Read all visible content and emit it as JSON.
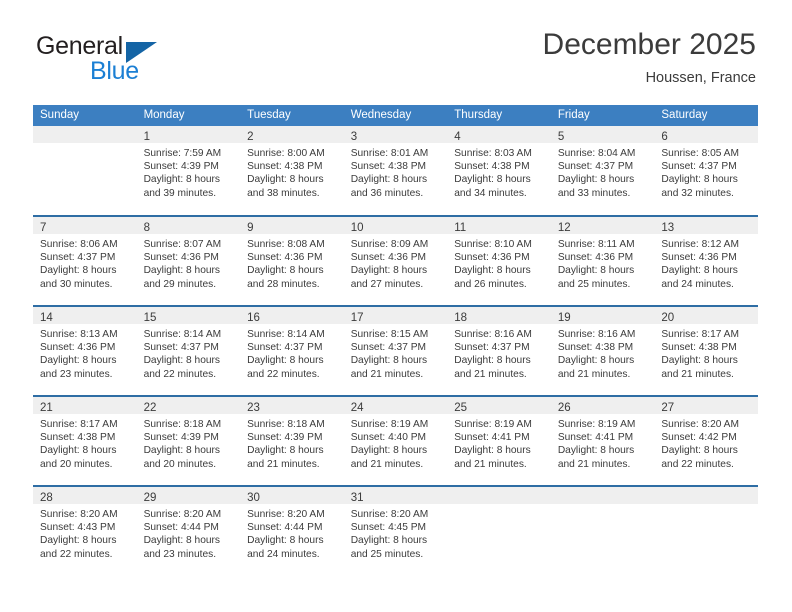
{
  "brand": {
    "name_top": "General",
    "name_bottom": "Blue",
    "accent_color": "#1b7fd4",
    "triangle_color": "#1464a5"
  },
  "header": {
    "title": "December 2025",
    "location": "Houssen, France"
  },
  "calendar": {
    "header_bg": "#3c7fc1",
    "row_divider_color": "#2e6da4",
    "daynum_band_bg": "#efefef",
    "weekdays": [
      "Sunday",
      "Monday",
      "Tuesday",
      "Wednesday",
      "Thursday",
      "Friday",
      "Saturday"
    ],
    "weeks": [
      [
        {
          "day": ""
        },
        {
          "day": "1",
          "sunrise": "Sunrise: 7:59 AM",
          "sunset": "Sunset: 4:39 PM",
          "daylight_line1": "Daylight: 8 hours",
          "daylight_line2": "and 39 minutes."
        },
        {
          "day": "2",
          "sunrise": "Sunrise: 8:00 AM",
          "sunset": "Sunset: 4:38 PM",
          "daylight_line1": "Daylight: 8 hours",
          "daylight_line2": "and 38 minutes."
        },
        {
          "day": "3",
          "sunrise": "Sunrise: 8:01 AM",
          "sunset": "Sunset: 4:38 PM",
          "daylight_line1": "Daylight: 8 hours",
          "daylight_line2": "and 36 minutes."
        },
        {
          "day": "4",
          "sunrise": "Sunrise: 8:03 AM",
          "sunset": "Sunset: 4:38 PM",
          "daylight_line1": "Daylight: 8 hours",
          "daylight_line2": "and 34 minutes."
        },
        {
          "day": "5",
          "sunrise": "Sunrise: 8:04 AM",
          "sunset": "Sunset: 4:37 PM",
          "daylight_line1": "Daylight: 8 hours",
          "daylight_line2": "and 33 minutes."
        },
        {
          "day": "6",
          "sunrise": "Sunrise: 8:05 AM",
          "sunset": "Sunset: 4:37 PM",
          "daylight_line1": "Daylight: 8 hours",
          "daylight_line2": "and 32 minutes."
        }
      ],
      [
        {
          "day": "7",
          "sunrise": "Sunrise: 8:06 AM",
          "sunset": "Sunset: 4:37 PM",
          "daylight_line1": "Daylight: 8 hours",
          "daylight_line2": "and 30 minutes."
        },
        {
          "day": "8",
          "sunrise": "Sunrise: 8:07 AM",
          "sunset": "Sunset: 4:36 PM",
          "daylight_line1": "Daylight: 8 hours",
          "daylight_line2": "and 29 minutes."
        },
        {
          "day": "9",
          "sunrise": "Sunrise: 8:08 AM",
          "sunset": "Sunset: 4:36 PM",
          "daylight_line1": "Daylight: 8 hours",
          "daylight_line2": "and 28 minutes."
        },
        {
          "day": "10",
          "sunrise": "Sunrise: 8:09 AM",
          "sunset": "Sunset: 4:36 PM",
          "daylight_line1": "Daylight: 8 hours",
          "daylight_line2": "and 27 minutes."
        },
        {
          "day": "11",
          "sunrise": "Sunrise: 8:10 AM",
          "sunset": "Sunset: 4:36 PM",
          "daylight_line1": "Daylight: 8 hours",
          "daylight_line2": "and 26 minutes."
        },
        {
          "day": "12",
          "sunrise": "Sunrise: 8:11 AM",
          "sunset": "Sunset: 4:36 PM",
          "daylight_line1": "Daylight: 8 hours",
          "daylight_line2": "and 25 minutes."
        },
        {
          "day": "13",
          "sunrise": "Sunrise: 8:12 AM",
          "sunset": "Sunset: 4:36 PM",
          "daylight_line1": "Daylight: 8 hours",
          "daylight_line2": "and 24 minutes."
        }
      ],
      [
        {
          "day": "14",
          "sunrise": "Sunrise: 8:13 AM",
          "sunset": "Sunset: 4:36 PM",
          "daylight_line1": "Daylight: 8 hours",
          "daylight_line2": "and 23 minutes."
        },
        {
          "day": "15",
          "sunrise": "Sunrise: 8:14 AM",
          "sunset": "Sunset: 4:37 PM",
          "daylight_line1": "Daylight: 8 hours",
          "daylight_line2": "and 22 minutes."
        },
        {
          "day": "16",
          "sunrise": "Sunrise: 8:14 AM",
          "sunset": "Sunset: 4:37 PM",
          "daylight_line1": "Daylight: 8 hours",
          "daylight_line2": "and 22 minutes."
        },
        {
          "day": "17",
          "sunrise": "Sunrise: 8:15 AM",
          "sunset": "Sunset: 4:37 PM",
          "daylight_line1": "Daylight: 8 hours",
          "daylight_line2": "and 21 minutes."
        },
        {
          "day": "18",
          "sunrise": "Sunrise: 8:16 AM",
          "sunset": "Sunset: 4:37 PM",
          "daylight_line1": "Daylight: 8 hours",
          "daylight_line2": "and 21 minutes."
        },
        {
          "day": "19",
          "sunrise": "Sunrise: 8:16 AM",
          "sunset": "Sunset: 4:38 PM",
          "daylight_line1": "Daylight: 8 hours",
          "daylight_line2": "and 21 minutes."
        },
        {
          "day": "20",
          "sunrise": "Sunrise: 8:17 AM",
          "sunset": "Sunset: 4:38 PM",
          "daylight_line1": "Daylight: 8 hours",
          "daylight_line2": "and 21 minutes."
        }
      ],
      [
        {
          "day": "21",
          "sunrise": "Sunrise: 8:17 AM",
          "sunset": "Sunset: 4:38 PM",
          "daylight_line1": "Daylight: 8 hours",
          "daylight_line2": "and 20 minutes."
        },
        {
          "day": "22",
          "sunrise": "Sunrise: 8:18 AM",
          "sunset": "Sunset: 4:39 PM",
          "daylight_line1": "Daylight: 8 hours",
          "daylight_line2": "and 20 minutes."
        },
        {
          "day": "23",
          "sunrise": "Sunrise: 8:18 AM",
          "sunset": "Sunset: 4:39 PM",
          "daylight_line1": "Daylight: 8 hours",
          "daylight_line2": "and 21 minutes."
        },
        {
          "day": "24",
          "sunrise": "Sunrise: 8:19 AM",
          "sunset": "Sunset: 4:40 PM",
          "daylight_line1": "Daylight: 8 hours",
          "daylight_line2": "and 21 minutes."
        },
        {
          "day": "25",
          "sunrise": "Sunrise: 8:19 AM",
          "sunset": "Sunset: 4:41 PM",
          "daylight_line1": "Daylight: 8 hours",
          "daylight_line2": "and 21 minutes."
        },
        {
          "day": "26",
          "sunrise": "Sunrise: 8:19 AM",
          "sunset": "Sunset: 4:41 PM",
          "daylight_line1": "Daylight: 8 hours",
          "daylight_line2": "and 21 minutes."
        },
        {
          "day": "27",
          "sunrise": "Sunrise: 8:20 AM",
          "sunset": "Sunset: 4:42 PM",
          "daylight_line1": "Daylight: 8 hours",
          "daylight_line2": "and 22 minutes."
        }
      ],
      [
        {
          "day": "28",
          "sunrise": "Sunrise: 8:20 AM",
          "sunset": "Sunset: 4:43 PM",
          "daylight_line1": "Daylight: 8 hours",
          "daylight_line2": "and 22 minutes."
        },
        {
          "day": "29",
          "sunrise": "Sunrise: 8:20 AM",
          "sunset": "Sunset: 4:44 PM",
          "daylight_line1": "Daylight: 8 hours",
          "daylight_line2": "and 23 minutes."
        },
        {
          "day": "30",
          "sunrise": "Sunrise: 8:20 AM",
          "sunset": "Sunset: 4:44 PM",
          "daylight_line1": "Daylight: 8 hours",
          "daylight_line2": "and 24 minutes."
        },
        {
          "day": "31",
          "sunrise": "Sunrise: 8:20 AM",
          "sunset": "Sunset: 4:45 PM",
          "daylight_line1": "Daylight: 8 hours",
          "daylight_line2": "and 25 minutes."
        },
        {
          "day": ""
        },
        {
          "day": ""
        },
        {
          "day": ""
        }
      ]
    ]
  }
}
